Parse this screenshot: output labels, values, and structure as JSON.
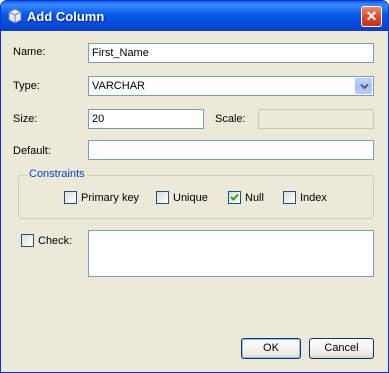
{
  "window": {
    "title": "Add Column",
    "close_label": "✕"
  },
  "form": {
    "name": {
      "label": "Name:",
      "value": "First_Name"
    },
    "type": {
      "label": "Type:",
      "value": "VARCHAR"
    },
    "size": {
      "label": "Size:",
      "value": "20"
    },
    "scale": {
      "label": "Scale:",
      "value": ""
    },
    "default": {
      "label": "Default:",
      "value": ""
    }
  },
  "constraints": {
    "title": "Constraints",
    "items": [
      {
        "label": "Primary key",
        "checked": false
      },
      {
        "label": "Unique",
        "checked": false
      },
      {
        "label": "Null",
        "checked": true
      },
      {
        "label": "Index",
        "checked": false
      }
    ]
  },
  "check": {
    "label": "Check:",
    "checked": false,
    "value": ""
  },
  "buttons": {
    "ok": "OK",
    "cancel": "Cancel"
  }
}
